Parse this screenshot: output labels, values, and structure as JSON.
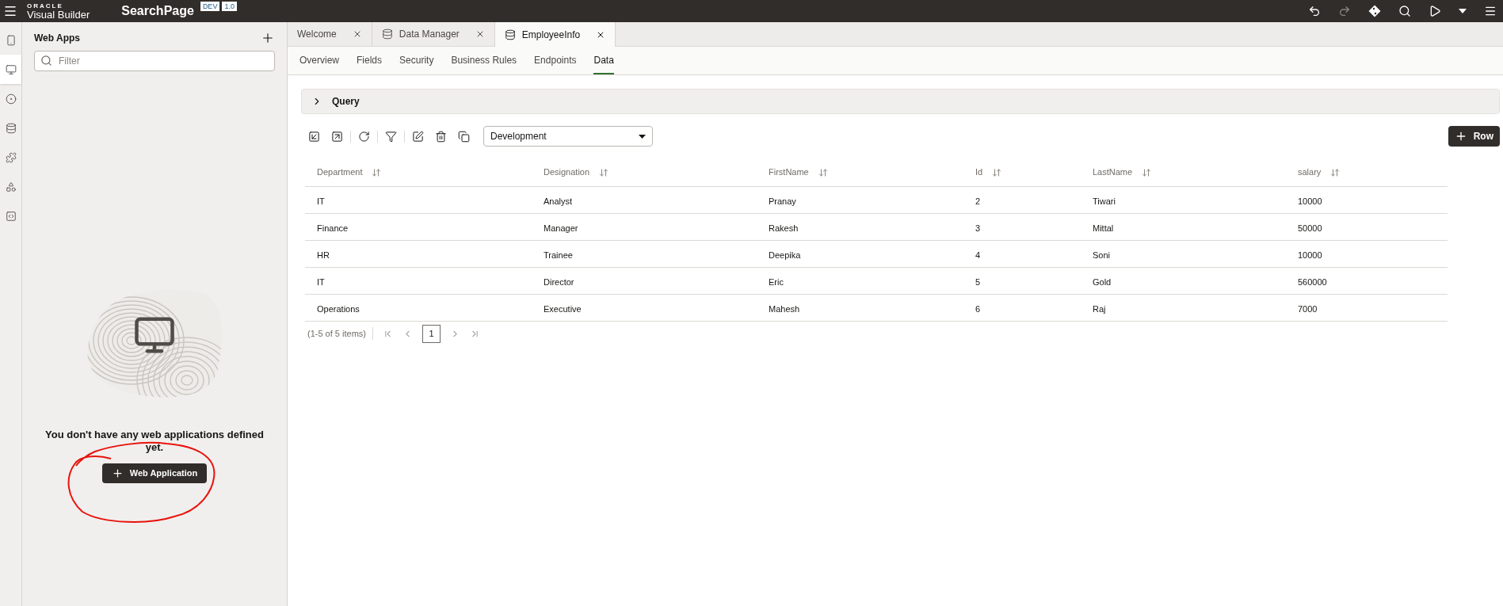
{
  "header": {
    "logo_top": "ORACLE",
    "logo": "Visual Builder",
    "page": "SearchPage",
    "badges": [
      "DEV",
      "1.0"
    ],
    "actions": [
      {
        "kind": "undo",
        "disabled": false
      },
      {
        "kind": "redo",
        "disabled": true
      },
      {
        "kind": "git",
        "disabled": false
      },
      {
        "kind": "search",
        "disabled": false
      },
      {
        "kind": "run",
        "disabled": false
      },
      {
        "kind": "caret",
        "disabled": false
      },
      {
        "kind": "menu",
        "disabled": false
      }
    ]
  },
  "rail": [
    {
      "kind": "mobile",
      "selected": false
    },
    {
      "kind": "web",
      "selected": true
    },
    {
      "kind": "service",
      "selected": false
    },
    {
      "kind": "database",
      "selected": false
    },
    {
      "kind": "component",
      "selected": false
    },
    {
      "kind": "process",
      "selected": false
    },
    {
      "kind": "source",
      "selected": false
    }
  ],
  "sidebar": {
    "title": "Web Apps",
    "filter": {
      "placeholder": "Filter"
    },
    "empty_message": "You don't have any web applications defined yet.",
    "button": "Web Application",
    "annotation": true
  },
  "tabs": [
    {
      "label": "Welcome",
      "kind": "page",
      "selected": false
    },
    {
      "label": "Data Manager",
      "kind": "data",
      "selected": false
    },
    {
      "label": "EmployeeInfo",
      "kind": "data",
      "selected": true
    }
  ],
  "subtabs": [
    {
      "label": "Overview",
      "selected": false
    },
    {
      "label": "Fields",
      "selected": false
    },
    {
      "label": "Security",
      "selected": false
    },
    {
      "label": "Business Rules",
      "selected": false
    },
    {
      "label": "Endpoints",
      "selected": false
    },
    {
      "label": "Data",
      "selected": true
    }
  ],
  "query": {
    "label": "Query",
    "expanded": false
  },
  "toolbar": {
    "groups": [
      [
        {
          "kind": "import"
        },
        {
          "kind": "export"
        }
      ],
      [
        {
          "kind": "refresh"
        }
      ],
      [
        {
          "kind": "filter"
        }
      ],
      [
        {
          "kind": "edit"
        },
        {
          "kind": "delete"
        },
        {
          "kind": "duplicate"
        }
      ]
    ],
    "dropdown": "Development",
    "add_button": "Row"
  },
  "table": {
    "columns": [
      "Department",
      "Designation",
      "FirstName",
      "Id",
      "LastName",
      "salary"
    ],
    "rows": [
      [
        "IT",
        "Analyst",
        "Pranay",
        "2",
        "Tiwari",
        "10000"
      ],
      [
        "Finance",
        "Manager",
        "Rakesh",
        "3",
        "Mittal",
        "50000"
      ],
      [
        "HR",
        "Trainee",
        "Deepika",
        "4",
        "Soni",
        "10000"
      ],
      [
        "IT",
        "Director",
        "Eric",
        "5",
        "Gold",
        "560000"
      ],
      [
        "Operations",
        "Executive",
        "Mahesh",
        "6",
        "Raj",
        "7000"
      ]
    ]
  },
  "pagination": {
    "summary": "(1-5 of 5 items)",
    "page": "1"
  }
}
